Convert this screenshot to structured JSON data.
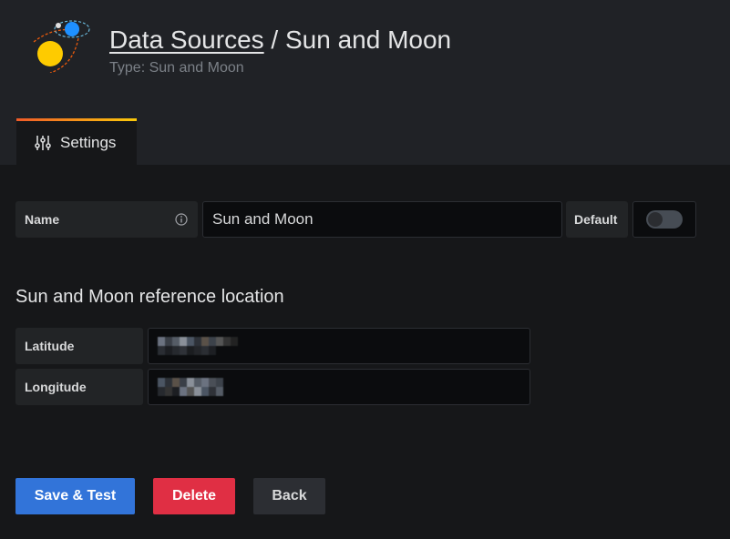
{
  "header": {
    "breadcrumb_link": "Data Sources",
    "separator": " / ",
    "title": "Sun and Moon",
    "subtitle": "Type: Sun and Moon",
    "logo_icon": "sun-and-moon-logo"
  },
  "tabs": [
    {
      "label": "Settings",
      "icon": "sliders-icon",
      "active": true
    }
  ],
  "form": {
    "name_label": "Name",
    "name_value": "Sun and Moon",
    "info_icon": "info-circle-icon",
    "default_label": "Default",
    "default_enabled": false,
    "section_title": "Sun and Moon reference location",
    "latitude_label": "Latitude",
    "longitude_label": "Longitude"
  },
  "buttons": {
    "save": "Save & Test",
    "delete": "Delete",
    "back": "Back"
  },
  "colors": {
    "primary": "#3274d9",
    "danger": "#e02f44",
    "secondary": "#2c2e33",
    "accent_gradient": [
      "#f05a28",
      "#fbca0a"
    ]
  }
}
